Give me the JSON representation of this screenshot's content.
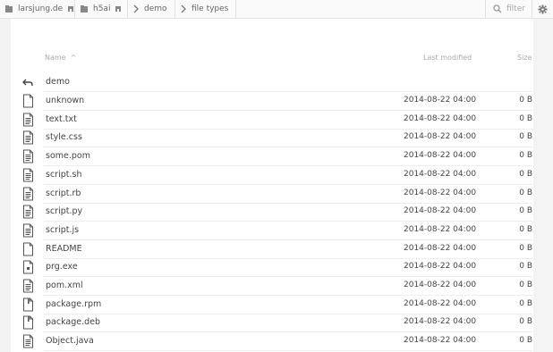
{
  "breadcrumbs": [
    {
      "label": "larsjung.de",
      "icon": "home-icon",
      "trailing_icon": "folder-home-icon"
    },
    {
      "label": "h5ai",
      "icon": "folder-icon",
      "trailing_icon": "folder-home-icon"
    },
    {
      "label": "demo",
      "icon": "chevron-right-icon"
    },
    {
      "label": "file types",
      "icon": "chevron-right-icon"
    }
  ],
  "filter": {
    "placeholder": "filter",
    "icon": "search-icon"
  },
  "settings": {
    "icon": "gear-icon"
  },
  "columns": {
    "name": "Name",
    "sort_indicator": "^",
    "modified": "Last modified",
    "size": "Size"
  },
  "parent": {
    "label": "demo",
    "icon": "back-arrow-icon"
  },
  "files": [
    {
      "name": "unknown",
      "modified": "2014-08-22 04:00",
      "size": "0 B",
      "icon": "blank-file-icon"
    },
    {
      "name": "text.txt",
      "modified": "2014-08-22 04:00",
      "size": "0 B",
      "icon": "text-file-icon"
    },
    {
      "name": "style.css",
      "modified": "2014-08-22 04:00",
      "size": "0 B",
      "icon": "text-file-icon"
    },
    {
      "name": "some.pom",
      "modified": "2014-08-22 04:00",
      "size": "0 B",
      "icon": "text-file-icon"
    },
    {
      "name": "script.sh",
      "modified": "2014-08-22 04:00",
      "size": "0 B",
      "icon": "text-file-icon"
    },
    {
      "name": "script.rb",
      "modified": "2014-08-22 04:00",
      "size": "0 B",
      "icon": "text-file-icon"
    },
    {
      "name": "script.py",
      "modified": "2014-08-22 04:00",
      "size": "0 B",
      "icon": "text-file-icon"
    },
    {
      "name": "script.js",
      "modified": "2014-08-22 04:00",
      "size": "0 B",
      "icon": "text-file-icon"
    },
    {
      "name": "README",
      "modified": "2014-08-22 04:00",
      "size": "0 B",
      "icon": "blank-file-icon"
    },
    {
      "name": "prg.exe",
      "modified": "2014-08-22 04:00",
      "size": "0 B",
      "icon": "binary-file-icon"
    },
    {
      "name": "pom.xml",
      "modified": "2014-08-22 04:00",
      "size": "0 B",
      "icon": "text-file-icon"
    },
    {
      "name": "package.rpm",
      "modified": "2014-08-22 04:00",
      "size": "0 B",
      "icon": "package-file-icon"
    },
    {
      "name": "package.deb",
      "modified": "2014-08-22 04:00",
      "size": "0 B",
      "icon": "package-file-icon"
    },
    {
      "name": "Object.java",
      "modified": "2014-08-22 04:00",
      "size": "0 B",
      "icon": "text-file-icon"
    }
  ]
}
